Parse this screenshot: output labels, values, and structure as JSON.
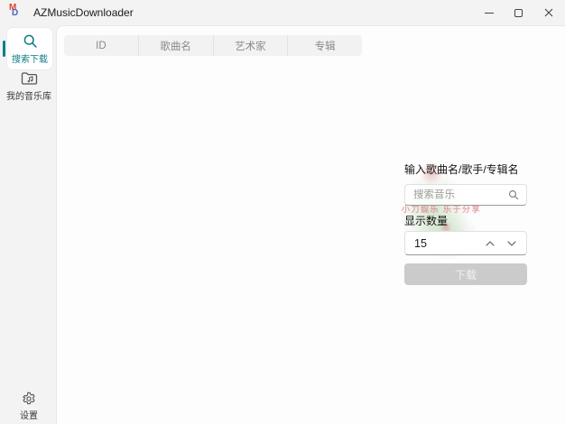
{
  "window": {
    "title": "AZMusicDownloader"
  },
  "sidebar": {
    "items": [
      {
        "label": "搜索下载",
        "active": true
      },
      {
        "label": "我的音乐库",
        "active": false
      }
    ],
    "settings_label": "设置"
  },
  "table": {
    "columns": [
      "ID",
      "歌曲名",
      "艺术家",
      "专辑"
    ]
  },
  "search_panel": {
    "input_label": "输入歌曲名/歌手/专辑名",
    "search_placeholder": "搜索音乐",
    "quantity_label": "显示数量",
    "quantity_value": "15",
    "download_label": "下载",
    "watermark_text": "小刀娱乐 乐于分享"
  },
  "colors": {
    "accent_teal": "#0f7c88",
    "titlebar_bg": "#f3f3f3",
    "card_bg": "#fdfdfd",
    "disabled_button_bg": "#cbcbcb"
  }
}
